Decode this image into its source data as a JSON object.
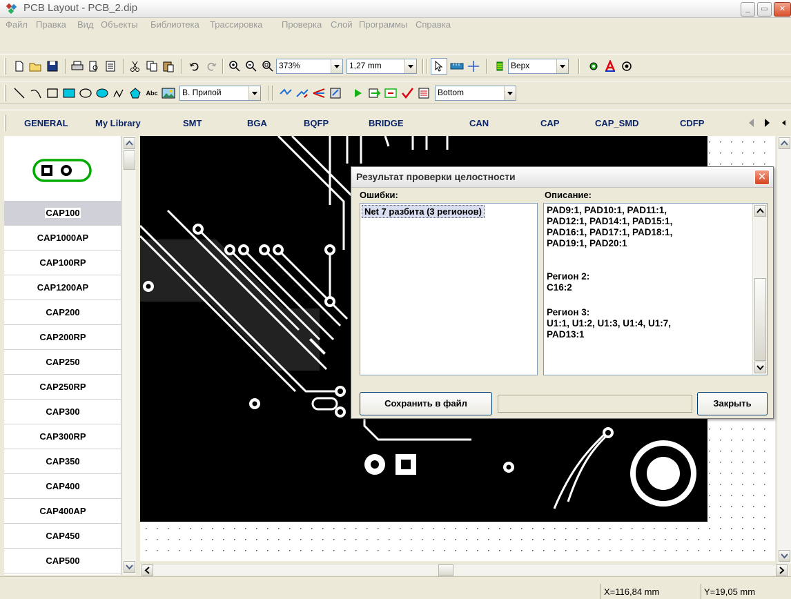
{
  "window": {
    "title": "PCB Layout - PCB_2.dip",
    "minimize_label": "_",
    "maximize_label": "▭",
    "close_label": "✕"
  },
  "menu": [
    "Файл",
    "Правка",
    "Вид",
    "Объекты",
    "Библиотека",
    "Трассировка",
    "Проверка",
    "Слой",
    "Программы",
    "Справка"
  ],
  "toolbar1": {
    "zoom_value": "373%",
    "grid_value": "1,27 mm",
    "layer_value": "Верх"
  },
  "toolbar2": {
    "text_tool_label": "Abc",
    "style_value": "В. Припой",
    "side_value": "Bottom"
  },
  "library_tabs": [
    "GENERAL",
    "My Library",
    "SMT",
    "BGA",
    "BQFP",
    "BRIDGE",
    "CAN",
    "CAP",
    "CAP_SMD",
    "CDFP"
  ],
  "components": {
    "selected": "CAP100",
    "items": [
      "CAP1000AP",
      "CAP100RP",
      "CAP1200AP",
      "CAP200",
      "CAP200RP",
      "CAP250",
      "CAP250RP",
      "CAP300",
      "CAP300RP",
      "CAP350",
      "CAP400",
      "CAP400AP",
      "CAP450",
      "CAP500"
    ]
  },
  "dialog": {
    "title": "Результат проверки целостности",
    "errors_label": "Ошибки:",
    "description_label": "Описание:",
    "error_item": "Net 7 разбита (3 регионов)",
    "description_lines": [
      "PAD9:1, PAD10:1, PAD11:1,",
      "PAD12:1, PAD14:1, PAD15:1,",
      "PAD16:1, PAD17:1, PAD18:1,",
      "PAD19:1, PAD20:1",
      "",
      "Регион 2:",
      "C16:2",
      "",
      "Регион 3:",
      "U1:1, U1:2, U1:3, U1:4, U1:7,",
      "PAD13:1"
    ],
    "save_button": "Сохранить в файл",
    "close_button": "Закрыть"
  },
  "status": {
    "x_coord": "X=116,84 mm",
    "y_coord": "Y=19,05 mm"
  }
}
